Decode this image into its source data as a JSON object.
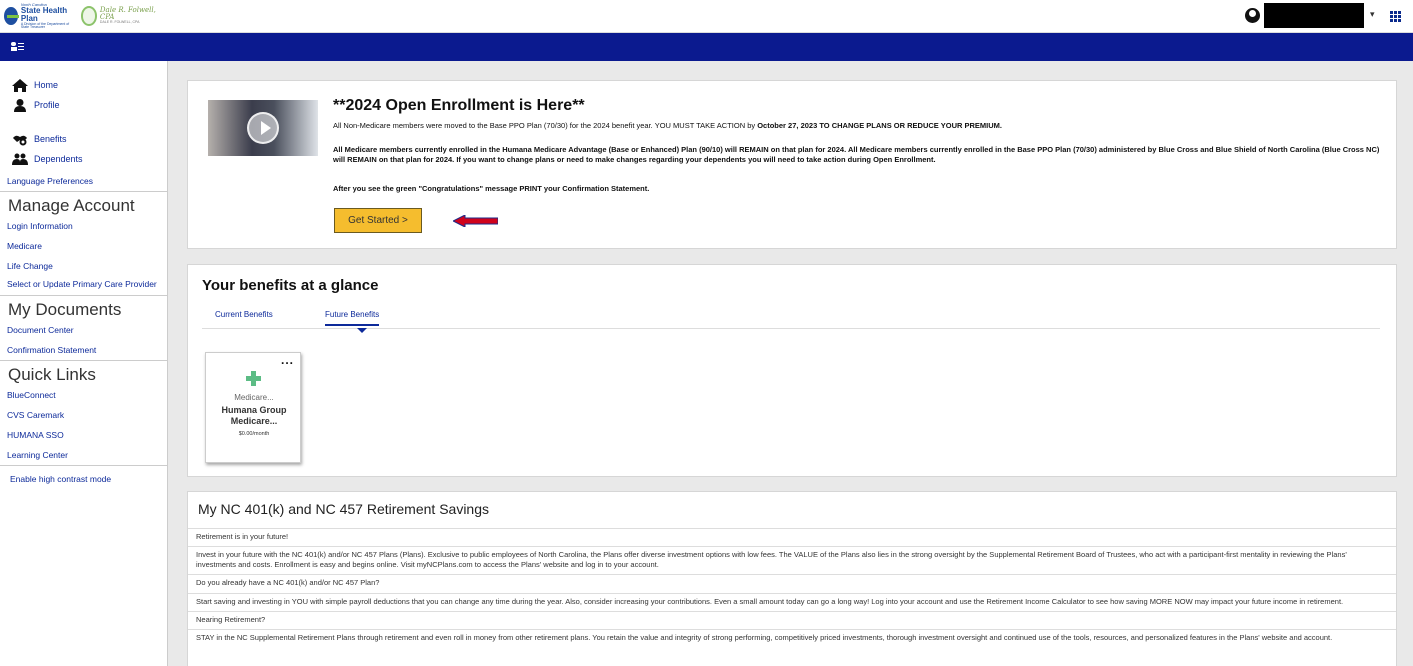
{
  "header": {
    "logo": {
      "small_text": "North Carolina",
      "main_text": "State Health Plan",
      "sub_text": "A Division of the Department of State Treasurer",
      "signature": "Dale R. Folwell, CPA",
      "signature_sub": "DALE R. FOLWELL, CPA"
    },
    "menu_icon": "apps-grid-icon"
  },
  "sidebar": {
    "nav": [
      {
        "label": "Home",
        "icon": "home-icon"
      },
      {
        "label": "Profile",
        "icon": "person-icon"
      },
      {
        "label": "Benefits",
        "icon": "benefits-icon"
      },
      {
        "label": "Dependents",
        "icon": "dependents-icon"
      }
    ],
    "language": "Language Preferences",
    "manage_account": {
      "title": "Manage Account",
      "links": [
        "Login Information",
        "Medicare",
        "Life Change",
        "Select or Update Primary Care Provider"
      ]
    },
    "my_documents": {
      "title": "My Documents",
      "links": [
        "Document Center",
        "Confirmation Statement"
      ]
    },
    "quick_links": {
      "title": "Quick Links",
      "links": [
        "BlueConnect",
        "CVS Caremark",
        "HUMANA SSO",
        "Learning Center"
      ]
    },
    "contrast": "Enable high contrast mode"
  },
  "enrollment": {
    "title": "**2024 Open Enrollment is Here**",
    "p1_start": "All Non-Medicare members were moved to the Base PPO Plan (70/30) for the 2024 benefit year. YOU MUST TAKE ACTION by ",
    "p1_bold": "October 27, 2023 TO CHANGE PLANS OR REDUCE YOUR PREMIUM.",
    "p2": "All Medicare members currently enrolled in the Humana Medicare Advantage (Base or Enhanced) Plan (90/10) will REMAIN on that plan for 2024. All Medicare members currently enrolled in the Base PPO Plan (70/30) administered by Blue Cross and Blue Shield of North Carolina (Blue Cross NC) will REMAIN on that plan for 2024. If you want to change plans or need to make changes regarding your dependents you will need to take action during Open Enrollment.",
    "p3": "After you see the green \"Congratulations\" message PRINT your Confirmation Statement.",
    "button": "Get Started >",
    "accent_color": "#f5bd2e",
    "arrow_color": "#d0021b"
  },
  "glance": {
    "title": "Your benefits at a glance",
    "tabs": [
      "Current Benefits",
      "Future Benefits"
    ],
    "active_tab": "Future Benefits",
    "card": {
      "type": "Medicare...",
      "name": "Humana Group Medicare...",
      "price": "$0.00/month",
      "menu": "..."
    }
  },
  "retirement": {
    "title": "My NC 401(k) and NC 457 Retirement Savings",
    "rows": [
      "Retirement is in your future!",
      "Invest in your future with the NC 401(k) and/or NC 457 Plans (Plans). Exclusive to public employees of North Carolina, the Plans offer diverse investment options with low fees. The VALUE of the Plans also lies in the strong oversight by the Supplemental Retirement Board of Trustees, who act with a participant-first mentality in reviewing the Plans' investments and costs. Enrollment is easy and begins online. Visit myNCPlans.com to access the Plans' website and log in to your account.",
      "Do you already have a NC 401(k) and/or NC 457 Plan?",
      "Start saving and investing in YOU with simple payroll deductions that you can change any time during the year. Also, consider increasing your contributions. Even a small amount today can go a long way! Log into your account and use the Retirement Income Calculator to see how saving MORE NOW may impact your future income in retirement.",
      "Nearing Retirement?",
      "STAY in the NC Supplemental Retirement Plans through retirement and even roll in money from other retirement plans. You retain the value and integrity of strong performing, competitively priced investments, thorough investment oversight and continued use of the tools, resources, and personalized features in the Plans' website and account."
    ]
  },
  "colors": {
    "nav_blue": "#0b1a8f",
    "link_blue": "#0d2a9a",
    "plus_green": "#5cbc85"
  }
}
